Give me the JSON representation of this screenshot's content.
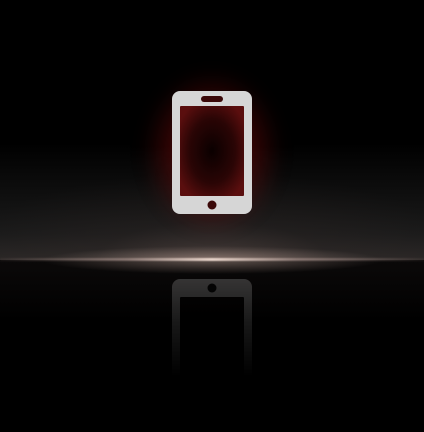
{
  "scene": {
    "icon": "smartphone-icon",
    "colors": {
      "background": "#000000",
      "icon_fill": "#d9d9d9",
      "glow": "#b01414",
      "screen_inner": "#2a0606",
      "horizon": "#e8d6cc"
    }
  }
}
